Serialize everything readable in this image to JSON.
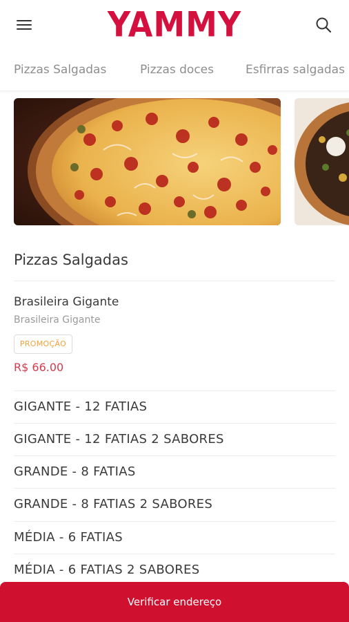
{
  "header": {
    "menu_icon": "hamburger-menu-icon",
    "logo_text": "YAMMY",
    "search_icon": "search-icon",
    "brand_color": "#d4103e"
  },
  "tabs": [
    {
      "label": "Pizzas Salgadas"
    },
    {
      "label": "Pizzas doces"
    },
    {
      "label": "Esfirras salgadas"
    }
  ],
  "banners": [
    {
      "image": "pepperoni-onion-pizza-photo"
    },
    {
      "image": "dark-topping-pizza-photo"
    }
  ],
  "section": {
    "title": "Pizzas Salgadas"
  },
  "product": {
    "name": "Brasileira Gigante",
    "description": "Brasileira Gigante",
    "badge": "PROMOÇÃO",
    "badge_color": "#f4a33c",
    "price": "R$ 66.00",
    "price_color": "#d83a4d"
  },
  "sizes": [
    {
      "label": "GIGANTE - 12 FATIAS"
    },
    {
      "label": "GIGANTE - 12 FATIAS 2 SABORES"
    },
    {
      "label": "GRANDE - 8 FATIAS"
    },
    {
      "label": "GRANDE - 8 FATIAS 2 SABORES"
    },
    {
      "label": "MÉDIA - 6 FATIAS"
    },
    {
      "label": "MÉDIA - 6 FATIAS 2 SABORES"
    }
  ],
  "cta": {
    "label": "Verificar endereço",
    "color": "#d0102f"
  }
}
